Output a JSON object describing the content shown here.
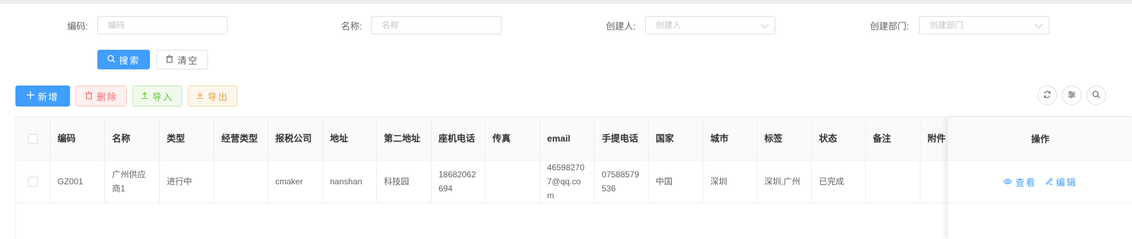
{
  "search": {
    "fields": [
      {
        "label": "编码:",
        "placeholder": "编码",
        "type": "text"
      },
      {
        "label": "名称:",
        "placeholder": "名称",
        "type": "text"
      },
      {
        "label": "创建人:",
        "placeholder": "创建人",
        "type": "select"
      },
      {
        "label": "创建部门:",
        "placeholder": "创建部门",
        "type": "select"
      }
    ],
    "search_label": "搜索",
    "clear_label": "清空"
  },
  "toolbar": {
    "add_label": "新增",
    "delete_label": "删除",
    "import_label": "导入",
    "export_label": "导出"
  },
  "table": {
    "columns": [
      "编码",
      "名称",
      "类型",
      "经营类型",
      "报税公司",
      "地址",
      "第二地址",
      "座机电话",
      "传真",
      "email",
      "手提电话",
      "国家",
      "城市",
      "标签",
      "状态",
      "备注",
      "附件"
    ],
    "action_header": "操作",
    "rows": [
      {
        "cells": [
          "GZ001",
          "广州供应商1",
          "进行中",
          "",
          "cmaker",
          "nanshan",
          "科技园",
          "18682062694",
          "",
          "465982707@qq.com",
          "07588579536",
          "中国",
          "深圳",
          "深圳,广州",
          "已完成",
          "",
          ""
        ],
        "view_label": "查看",
        "edit_label": "编辑"
      }
    ]
  },
  "colors": {
    "primary": "#409eff",
    "danger": "#f56c6c",
    "success": "#67c23a",
    "warning": "#e6a23c"
  }
}
